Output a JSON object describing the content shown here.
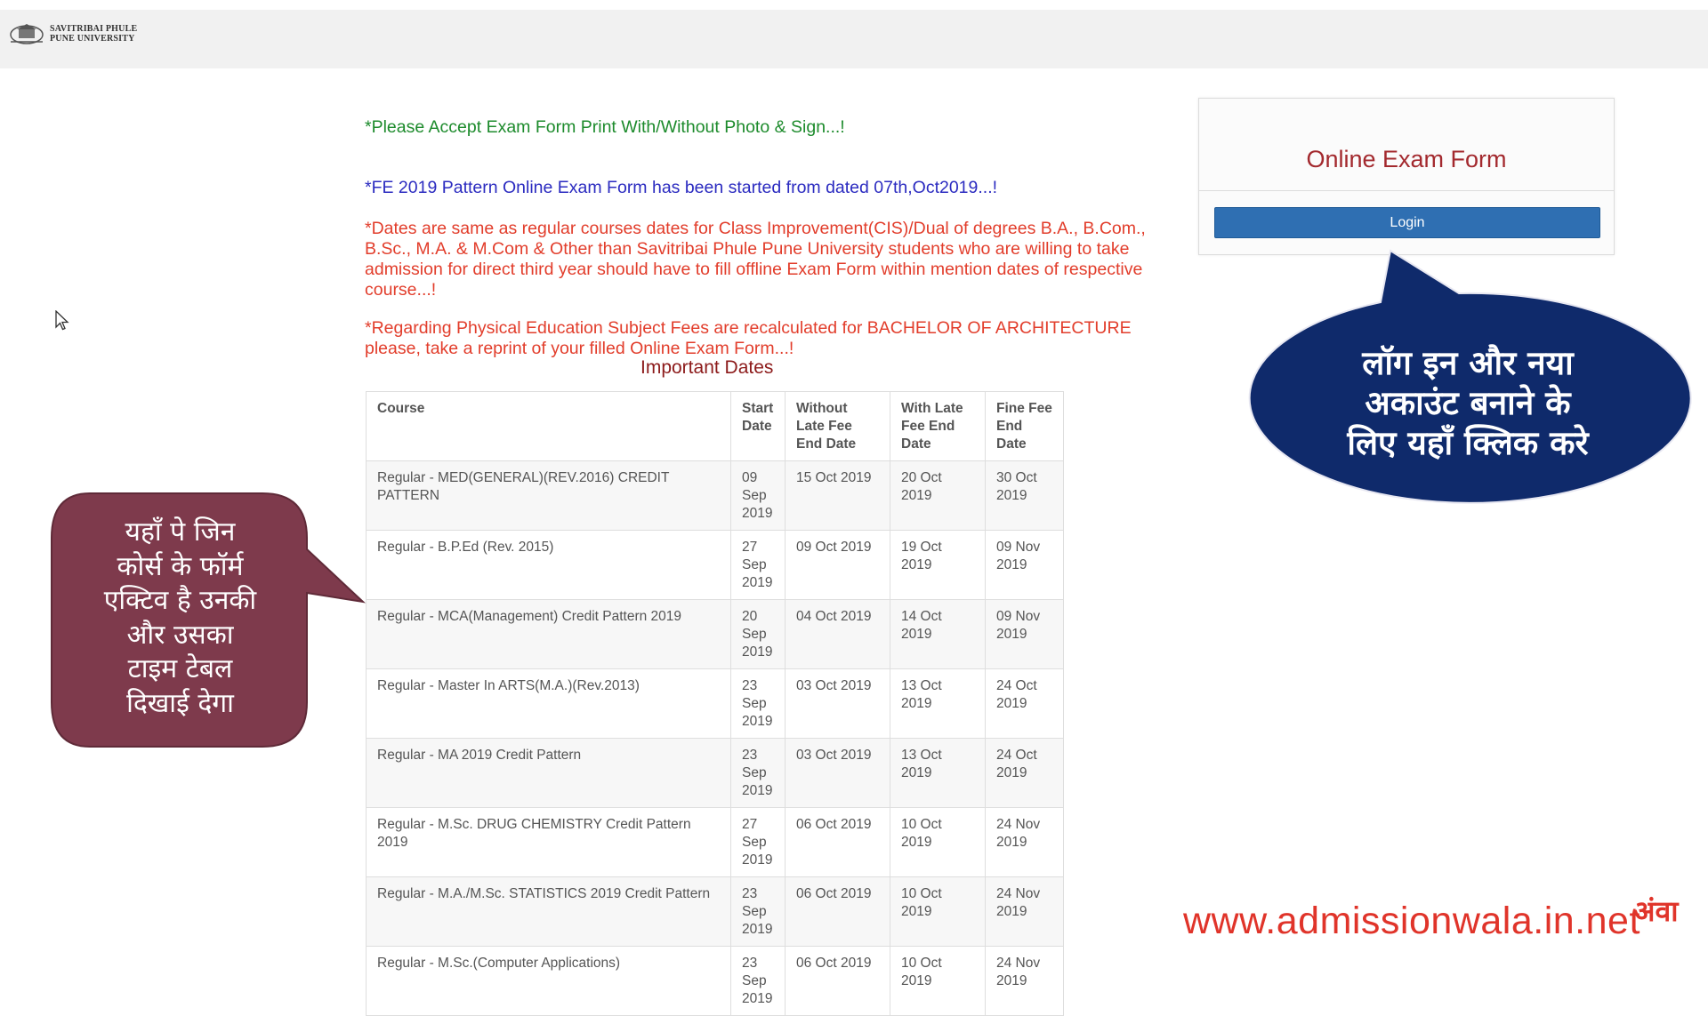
{
  "header": {
    "logo_line1": "SAVITRIBAI PHULE",
    "logo_line2": "PUNE UNIVERSITY"
  },
  "notices": {
    "green": "*Please Accept Exam Form Print With/Without Photo & Sign...!",
    "blue": "*FE 2019 Pattern Online Exam Form has been started from dated 07th,Oct2019...!",
    "red1": "*Dates are same as regular courses dates for Class Improvement(CIS)/Dual of degrees B.A., B.Com., B.Sc., M.A. & M.Com & Other than Savitribai Phule Pune University students who are willing to take admission for direct third year should have to fill offline Exam Form within mention dates of respective course...!",
    "red2": "*Regarding Physical Education Subject Fees are recalculated for BACHELOR OF ARCHITECTURE please, take a reprint of your filled Online Exam Form...!"
  },
  "important_dates": {
    "title": "Important Dates",
    "headers": [
      "Course",
      "Start Date",
      "Without Late Fee End Date",
      "With Late Fee End Date",
      "Fine Fee End Date"
    ],
    "rows": [
      [
        "Regular - MED(GENERAL)(REV.2016) CREDIT PATTERN",
        "09 Sep 2019",
        "15 Oct 2019",
        "20 Oct 2019",
        "30 Oct 2019"
      ],
      [
        "Regular - B.P.Ed (Rev. 2015)",
        "27 Sep 2019",
        "09 Oct 2019",
        "19 Oct 2019",
        "09 Nov 2019"
      ],
      [
        "Regular - MCA(Management) Credit Pattern 2019",
        "20 Sep 2019",
        "04 Oct 2019",
        "14 Oct 2019",
        "09 Nov 2019"
      ],
      [
        "Regular - Master In ARTS(M.A.)(Rev.2013)",
        "23 Sep 2019",
        "03 Oct 2019",
        "13 Oct 2019",
        "24 Oct 2019"
      ],
      [
        "Regular - MA 2019 Credit Pattern",
        "23 Sep 2019",
        "03 Oct 2019",
        "13 Oct 2019",
        "24 Oct 2019"
      ],
      [
        "Regular - M.Sc. DRUG CHEMISTRY Credit Pattern 2019",
        "27 Sep 2019",
        "06 Oct 2019",
        "10 Oct 2019",
        "24 Nov 2019"
      ],
      [
        "Regular - M.A./M.Sc. STATISTICS 2019 Credit Pattern",
        "23 Sep 2019",
        "06 Oct 2019",
        "10 Oct 2019",
        "24 Nov 2019"
      ],
      [
        "Regular - M.Sc.(Computer Applications)",
        "23 Sep 2019",
        "06 Oct 2019",
        "10 Oct 2019",
        "24 Nov 2019"
      ]
    ]
  },
  "exam_panel": {
    "title": "Online Exam Form",
    "login_label": "Login"
  },
  "callouts": {
    "right_line1": "लॉग इन और नया",
    "right_line2": "अकाउंट बनाने के",
    "right_line3": "लिए यहाँ क्लिक करे",
    "left_line1": "यहाँ पे जिन",
    "left_line2": "कोर्स के फॉर्म",
    "left_line3": "एक्टिव है उनकी",
    "left_line4": "और उसका",
    "left_line5": "टाइम टेबल",
    "left_line6": "दिखाई देगा"
  },
  "watermark": {
    "url": "www.admissionwala.in.net",
    "brand": "अंवा"
  },
  "colors": {
    "header_bg": "#f1f1f1",
    "notice_green": "#1d8b2c",
    "notice_blue": "#2b2bc0",
    "notice_red": "#e23d2b",
    "panel_title": "#a3292e",
    "login_button": "#2f6fb2",
    "callout_right": "#0f2a6b",
    "callout_left": "#7e3a4c"
  }
}
